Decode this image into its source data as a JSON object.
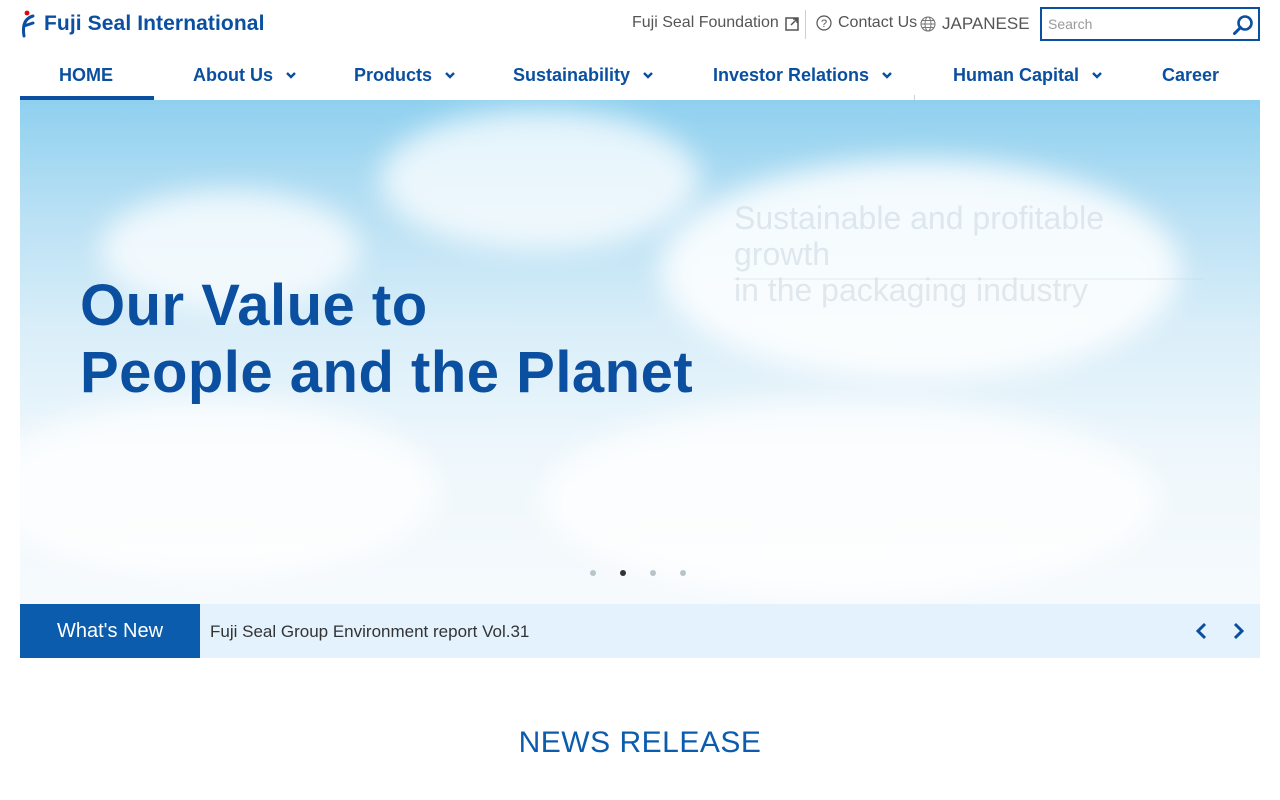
{
  "header": {
    "logo_text": "Fuji Seal International",
    "utility": {
      "foundation_label": "Fuji Seal Foundation",
      "contact_label": "Contact Us",
      "language_label": "JAPANESE"
    },
    "search": {
      "placeholder": "Search"
    }
  },
  "nav": {
    "items": [
      {
        "label": "HOME",
        "active": true
      },
      {
        "label": "About Us",
        "has_dropdown": true
      },
      {
        "label": "Products",
        "has_dropdown": true
      },
      {
        "label": "Sustainability",
        "has_dropdown": true
      },
      {
        "label": "Investor Relations",
        "has_dropdown": true
      },
      {
        "label": "Human Capital",
        "has_dropdown": true
      },
      {
        "label": "Career"
      }
    ]
  },
  "hero": {
    "headline_line1": "Our Value to",
    "headline_line2": "People and the Planet",
    "sub_line1": "Sustainable and profitable growth",
    "sub_line2": "in the packaging industry",
    "slide_count": 4,
    "active_slide": 2
  },
  "whats_new": {
    "label": "What's New",
    "item": "Fuji Seal Group Environment report Vol.31"
  },
  "news_release": {
    "title": "NEWS RELEASE"
  },
  "colors": {
    "brand_blue": "#0b4fa0",
    "label_blue": "#0b5cad",
    "news_bar_bg": "#e4f2fd",
    "logo_red": "#e60012"
  },
  "icons": [
    "external-link-icon",
    "question-circle-icon",
    "globe-icon",
    "search-icon",
    "chevron-down-icon",
    "chevron-left-icon",
    "chevron-right-icon"
  ]
}
